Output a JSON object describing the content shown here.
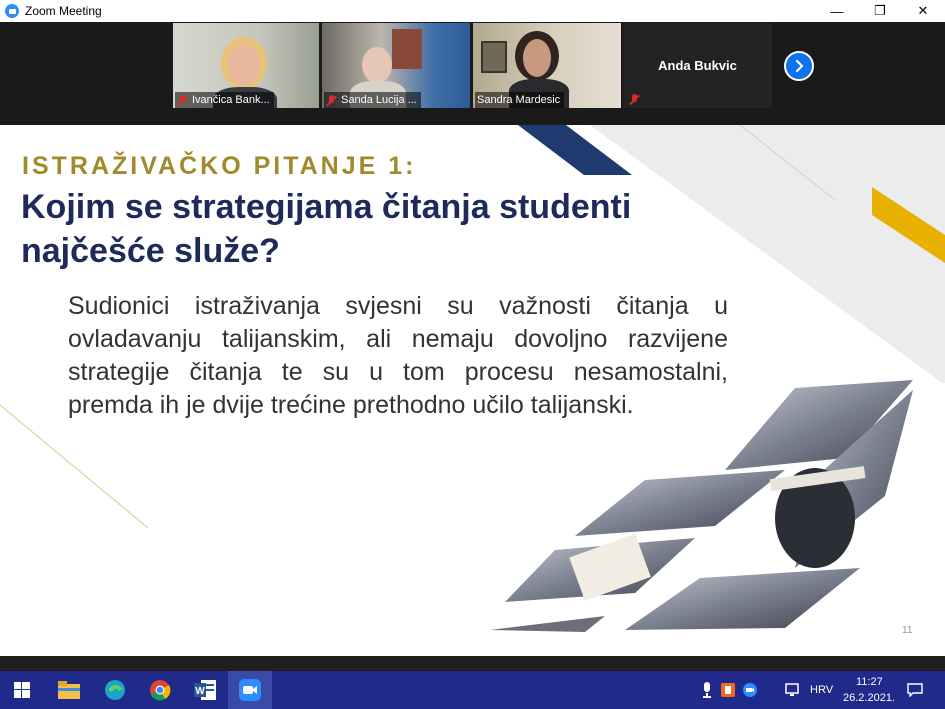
{
  "window": {
    "title": "Zoom Meeting",
    "controls": {
      "minimize": "—",
      "restore": "❐",
      "close": "✕"
    }
  },
  "participants": [
    {
      "name": "Ivančica Bank...",
      "muted": true
    },
    {
      "name": "Sanda Lucija ...",
      "muted": true
    },
    {
      "name": "Sandra Mardesic",
      "muted": false,
      "speaking": true
    },
    {
      "name": "Anda Bukvic",
      "muted": true,
      "video": false
    }
  ],
  "next_page_icon": "chevron-right-icon",
  "slide": {
    "subtitle": "ISTRAŽIVAČKO PITANJE 1:",
    "title": "Kojim se strategijama čitanja studenti najčešće služe?",
    "body": "Sudionici istraživanja svjesni su važnosti čitanja u ovladavanju talijanskim, ali nemaju dovoljno razvijene strategije čitanja te su u tom procesu nesamostalni, premda ih je dvije trećine prethodno učilo talijanski.",
    "page_number": "11",
    "colors": {
      "subtitle": "#a08a2a",
      "title": "#1e2a5a",
      "accent_navy": "#1e3a6e",
      "accent_gold": "#e8b000"
    }
  },
  "taskbar": {
    "apps": [
      "start-icon",
      "file-explorer-icon",
      "edge-icon",
      "chrome-icon",
      "word-icon",
      "zoom-icon"
    ],
    "language": "HRV",
    "time": "11:27",
    "date": "26.2.2021."
  }
}
